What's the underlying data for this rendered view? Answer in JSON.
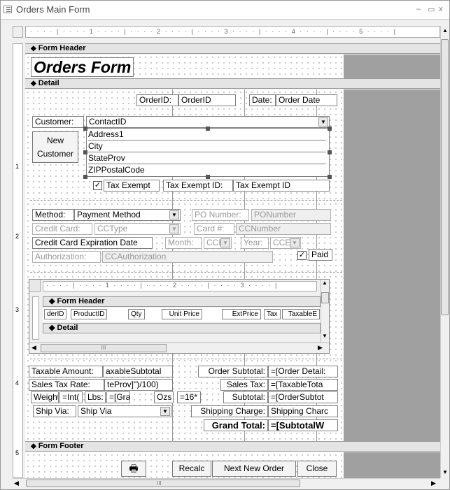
{
  "window": {
    "title": "Orders Main Form",
    "min": "–",
    "max": "▭",
    "close": "x"
  },
  "ruler": {
    "marks": [
      "1",
      "2",
      "3",
      "4",
      "5"
    ],
    "dots": "· · · · | · · · · 1 · · · · | · · · · 2 · · · · | · · · · 3 · · · · | · · · · 4 · · · · | · · · · 5 · · · · |"
  },
  "sections": {
    "form_header": "Form Header",
    "detail": "Detail",
    "form_footer": "Form Footer"
  },
  "header": {
    "title": "Orders Form"
  },
  "detail": {
    "orderid_label": "OrderID:",
    "orderid_field": "OrderID",
    "date_label": "Date:",
    "date_field": "Order Date",
    "customer_label": "Customer:",
    "customer_field": "ContactID",
    "new_customer": "New Customer",
    "address_lines": [
      "Address1",
      "City",
      "StateProv",
      "ZIPPostalCode"
    ],
    "tax_exempt_label": "Tax Exempt",
    "tax_exempt_id_label": "Tax Exempt ID:",
    "tax_exempt_id_field": "Tax Exempt ID",
    "method_label": "Method:",
    "method_field": "Payment Method",
    "po_label": "PO Number:",
    "po_field": "PONumber",
    "cc_label": "Credit Card:",
    "cc_field": "CCType",
    "card_label": "Card #:",
    "card_field": "CCNumber",
    "cc_exp_label": "Credit Card Expiration Date",
    "month_label": "Month:",
    "month_field": "CCE",
    "year_label": "Year:",
    "year_field": "CCE",
    "auth_label": "Authorization:",
    "auth_field": "CCAuthorization",
    "paid_label": "Paid",
    "taxable_label": "Taxable Amount:",
    "taxable_field": "axableSubtotal",
    "salestax_rate_label": "Sales Tax Rate:",
    "salestax_rate_field": "teProv]\")/100)",
    "weight_label": "Weight:",
    "weight_field": "=Int(",
    "lbs_label": "Lbs:",
    "lbs_field": "=[Gra",
    "ozs_label": "Ozs",
    "ozs_field": "=16*",
    "shipvia_label": "Ship Via:",
    "shipvia_field": "Ship Via",
    "order_subtotal_label": "Order Subtotal:",
    "order_subtotal_field": "=[Order Detail:",
    "sales_tax_label": "Sales Tax:",
    "sales_tax_field": "=[TaxableTota",
    "subtotal_label": "Subtotal:",
    "subtotal_field": "=[OrderSubtot",
    "shipping_label": "Shipping Charge:",
    "shipping_field": "Shipping Charc",
    "grand_total_label": "Grand Total:",
    "grand_total_field": "=[SubtotalW"
  },
  "subform": {
    "ruler": "· · · · | · · · · 1 · · · · | · · · · 2 · · · · | · · · · 3 · · · · |",
    "header": "Form Header",
    "detail": "Detail",
    "columns": [
      "derID",
      "ProductID",
      "Qty",
      "Unit Price",
      "ExtPrice",
      "Tax",
      "TaxableE"
    ],
    "hscroll_thumb": "III"
  },
  "footer": {
    "print_icon": "🖶",
    "recalc": "Recalc",
    "next_new_order": "Next New Order",
    "close": "Close"
  },
  "hscroll_thumb": "III"
}
